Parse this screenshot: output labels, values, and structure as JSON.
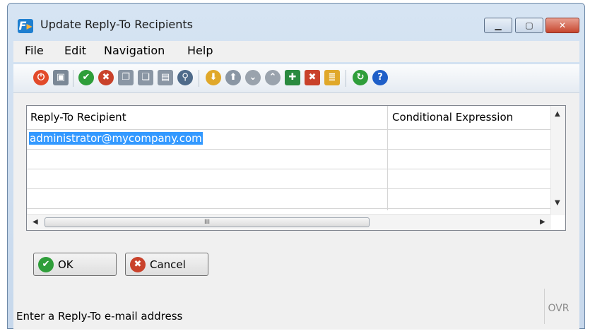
{
  "window": {
    "title": "Update Reply-To Recipients",
    "min_glyph": "▁",
    "max_glyph": "▢",
    "close_glyph": "✕"
  },
  "menu": {
    "items": [
      {
        "label": "File"
      },
      {
        "label": "Edit"
      },
      {
        "label": "Navigation"
      },
      {
        "label": "Help"
      }
    ]
  },
  "toolbar": {
    "icons": [
      {
        "name": "power-icon",
        "glyph": "⏻",
        "color": "#e24a2a"
      },
      {
        "name": "save-icon",
        "glyph": "▣",
        "color": "#7b8896"
      },
      {
        "name": "check-icon",
        "glyph": "✔",
        "color": "#2f9e3a"
      },
      {
        "name": "cancel-icon",
        "glyph": "✖",
        "color": "#c9422b"
      },
      {
        "name": "copy-icon",
        "glyph": "❐",
        "color": "#8a96a4"
      },
      {
        "name": "paste-icon",
        "glyph": "❏",
        "color": "#8a96a4"
      },
      {
        "name": "document-icon",
        "glyph": "▤",
        "color": "#8a96a4"
      },
      {
        "name": "zoom-icon",
        "glyph": "⚲",
        "color": "#4f6b8a"
      },
      {
        "name": "download-icon",
        "glyph": "⬇",
        "color": "#e0a82a"
      },
      {
        "name": "upload-icon",
        "glyph": "⬆",
        "color": "#8a96a4"
      },
      {
        "name": "move-down-icon",
        "glyph": "⌄",
        "color": "#9aa3ad"
      },
      {
        "name": "move-up-icon",
        "glyph": "⌃",
        "color": "#9aa3ad"
      },
      {
        "name": "insert-row-icon",
        "glyph": "✚",
        "color": "#2a8a3f"
      },
      {
        "name": "delete-row-icon",
        "glyph": "✖",
        "color": "#c9422b"
      },
      {
        "name": "properties-icon",
        "glyph": "≣",
        "color": "#e0a82a"
      },
      {
        "name": "refresh-icon",
        "glyph": "↻",
        "color": "#2f9e3a"
      },
      {
        "name": "help-icon",
        "glyph": "?",
        "color": "#1f5fc8"
      }
    ]
  },
  "grid": {
    "columns": [
      {
        "label": "Reply-To Recipient"
      },
      {
        "label": "Conditional Expression"
      }
    ],
    "rows": [
      {
        "recipient": "administrator@mycompany.com",
        "expression": ""
      },
      {
        "recipient": "",
        "expression": ""
      },
      {
        "recipient": "",
        "expression": ""
      },
      {
        "recipient": "",
        "expression": ""
      }
    ],
    "scroll_thumb_label": "III"
  },
  "buttons": {
    "ok_label": "OK",
    "cancel_label": "Cancel"
  },
  "status": {
    "text": "Enter a Reply-To e-mail address",
    "mode": "OVR"
  }
}
